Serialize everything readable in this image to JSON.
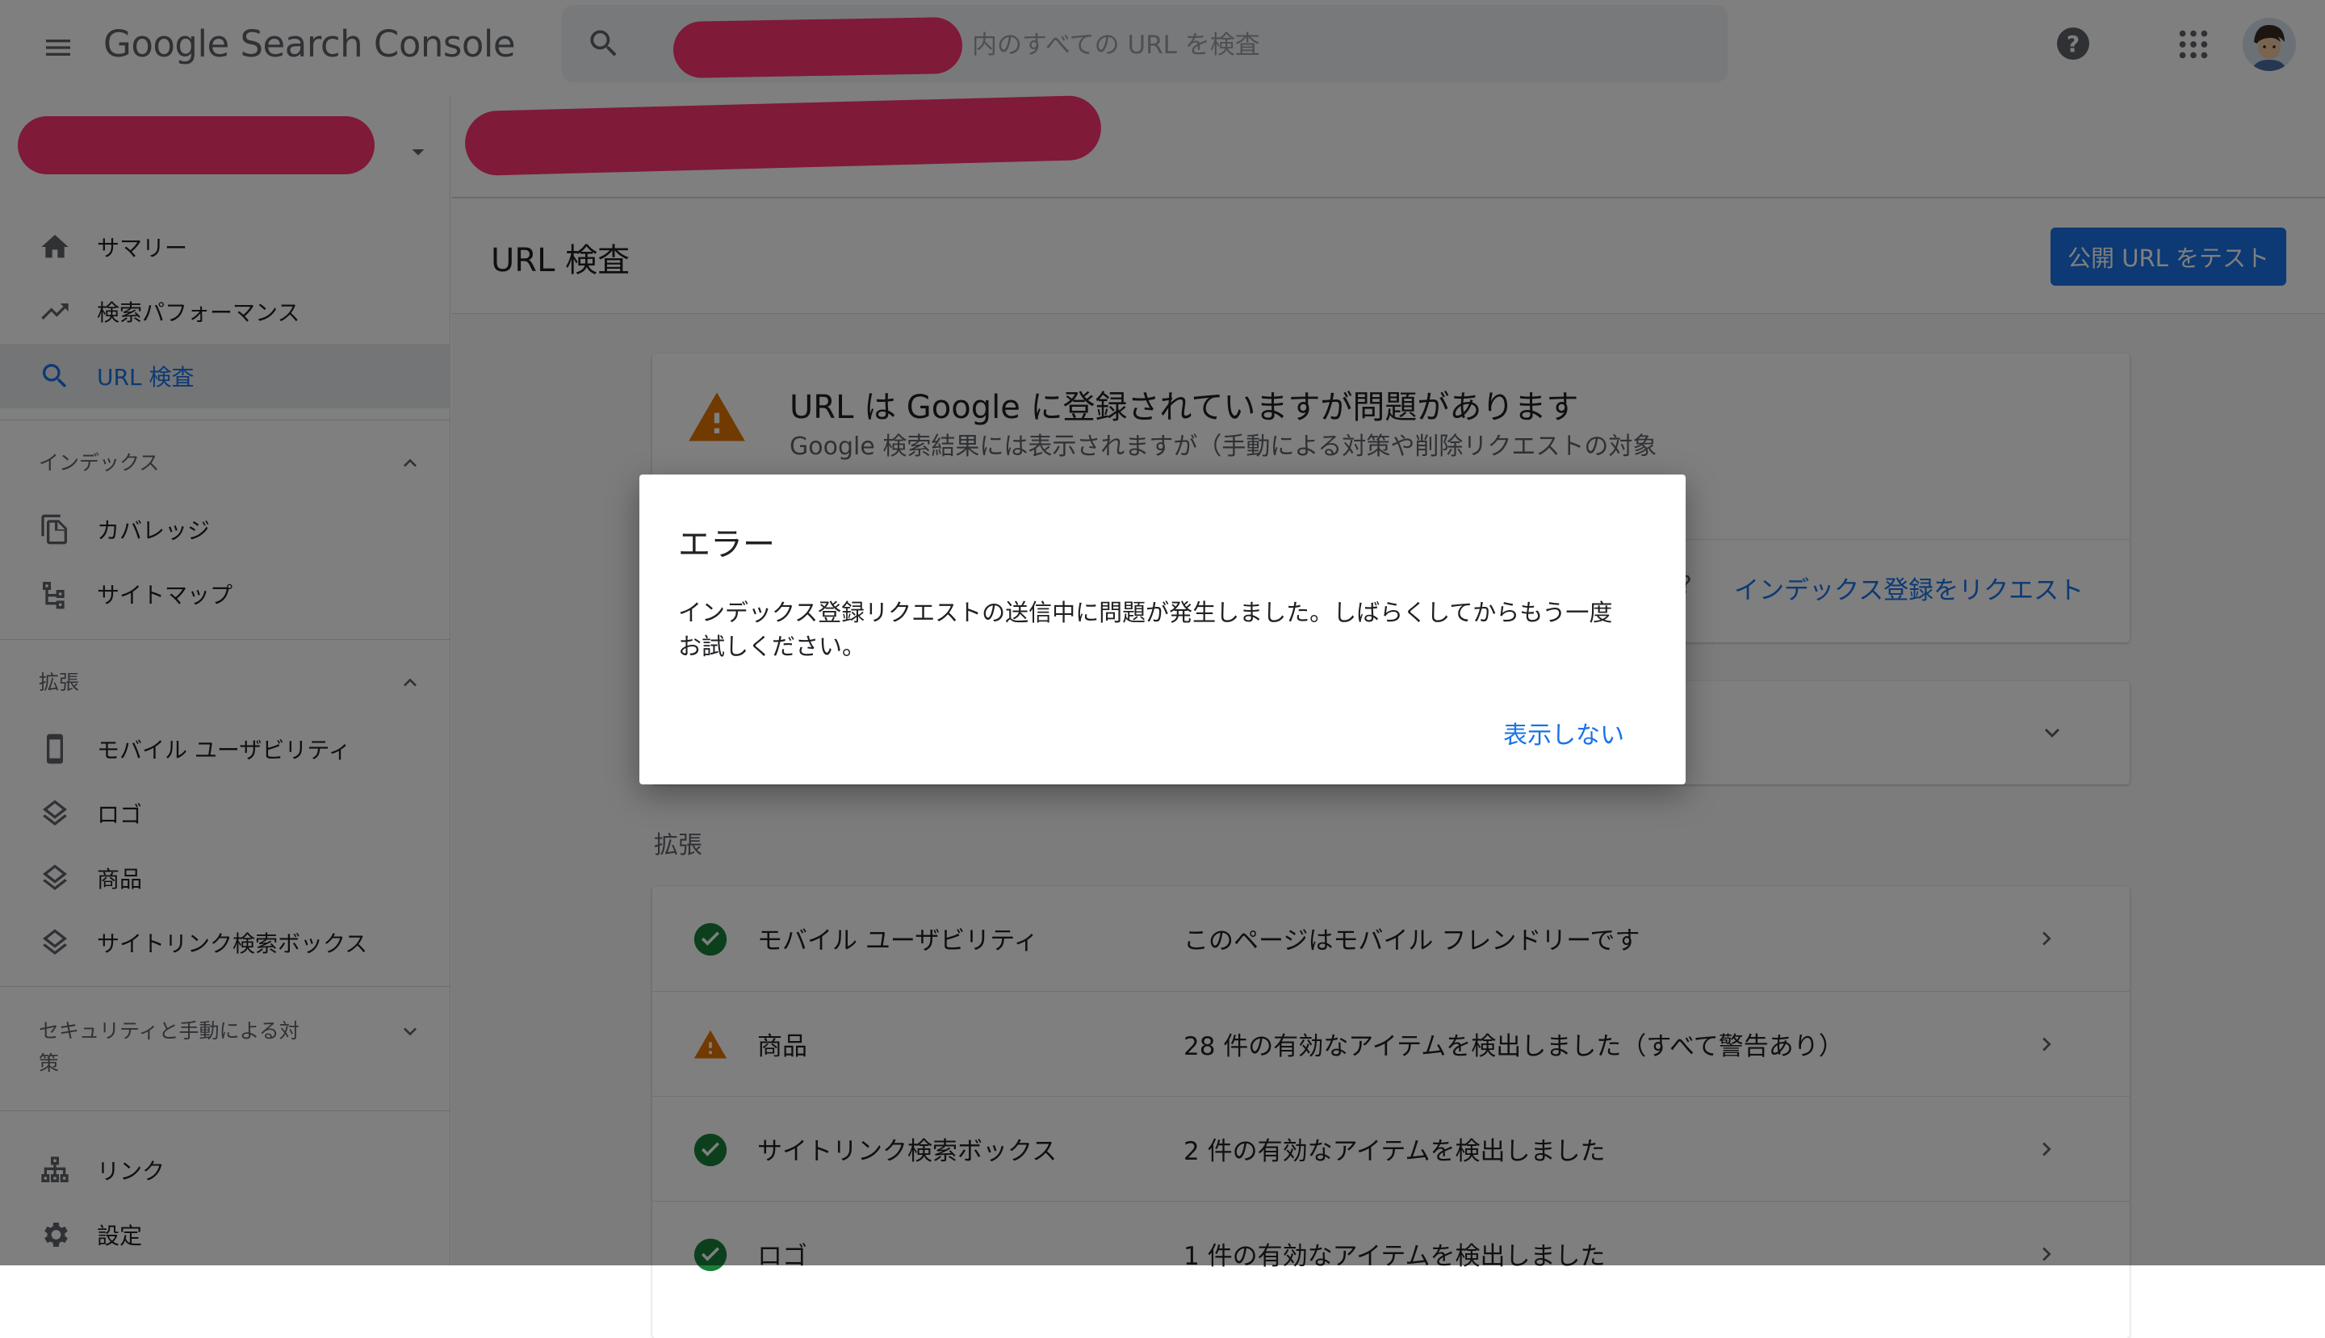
{
  "app": {
    "logo_text": "Google Search Console",
    "search_placeholder": "内のすべての URL を検査",
    "icons": {
      "menu": "hamburger-icon",
      "search": "search-icon",
      "help": "help-icon",
      "apps": "apps-grid-icon"
    }
  },
  "property": {
    "url_fragment": "/"
  },
  "sidebar": {
    "top_items": [
      {
        "label": "サマリー",
        "icon": "home-icon"
      },
      {
        "label": "検索パフォーマンス",
        "icon": "trending-up-icon"
      },
      {
        "label": "URL 検査",
        "icon": "search-icon",
        "active": true
      }
    ],
    "index_section": {
      "label": "インデックス",
      "items": [
        {
          "label": "カバレッジ",
          "icon": "coverage-icon"
        },
        {
          "label": "サイトマップ",
          "icon": "sitemap-icon"
        }
      ]
    },
    "enhancements_section": {
      "label": "拡張",
      "items": [
        {
          "label": "モバイル ユーザビリティ",
          "icon": "mobile-icon"
        },
        {
          "label": "ロゴ",
          "icon": "layers-icon"
        },
        {
          "label": "商品",
          "icon": "layers-icon"
        },
        {
          "label": "サイトリンク検索ボックス",
          "icon": "layers-icon"
        }
      ]
    },
    "security_section": {
      "label_line1": "セキュリティと手動による対",
      "label_line2": "策"
    },
    "bottom_items": [
      {
        "label": "リンク",
        "icon": "links-icon"
      },
      {
        "label": "設定",
        "icon": "settings-icon"
      }
    ]
  },
  "main": {
    "page_title": "URL 検査",
    "test_button": "公開 URL をテスト",
    "status_card": {
      "title": "URL は Google に登録されていますが問題があります",
      "description": "Google 検索結果には表示されますが（手動による対策や削除リクエストの対象",
      "question_mark": "?",
      "request_indexing": "インデックス登録をリクエスト"
    },
    "enhancements_label": "拡張",
    "enhancements": [
      {
        "name": "モバイル ユーザビリティ",
        "status": "このページはモバイル フレンドリーです",
        "state": "valid"
      },
      {
        "name": "商品",
        "status": "28 件の有効なアイテムを検出しました（すべて警告あり）",
        "state": "warning"
      },
      {
        "name": "サイトリンク検索ボックス",
        "status": "2 件の有効なアイテムを検出しました",
        "state": "valid"
      },
      {
        "name": "ロゴ",
        "status": "1 件の有効なアイテムを検出しました",
        "state": "valid"
      }
    ]
  },
  "dialog": {
    "title": "エラー",
    "body_line1": "インデックス登録リクエストの送信中に問題が発生しました。しばらくしてからもう一度",
    "body_line2": "お試しください。",
    "dismiss_button": "表示しない"
  },
  "colors": {
    "accent": "#1a73e8",
    "valid": "#188038",
    "warning": "#e37400",
    "redaction": "#ff3472"
  }
}
